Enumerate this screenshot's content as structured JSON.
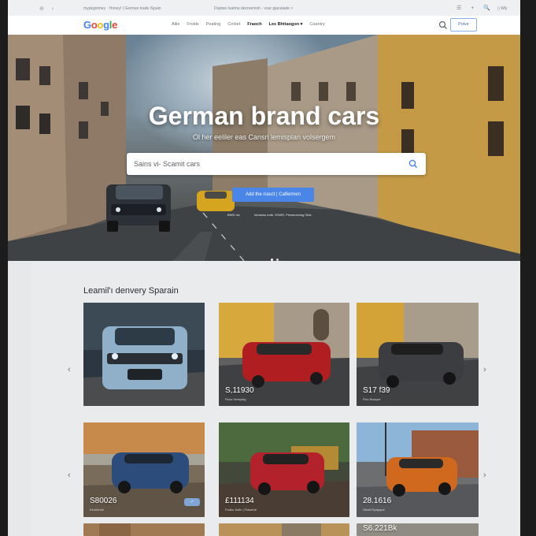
{
  "browser": {
    "nav_icons": "⊖ ›",
    "url": "mypkgiomey · Honey! | German trade iSpain",
    "tab": "Doptao loatma decreemoh - vour pjansiade ×",
    "tools": "☰ + 🔍",
    "user": "▯ Wly"
  },
  "header": {
    "logo_letters": [
      "G",
      "o",
      "o",
      "g",
      "l",
      "e"
    ],
    "menu": [
      "Allie",
      "Frolds",
      "Peating",
      "Crcket",
      "Fraoch",
      "Les Bhttaogon ▾",
      "Ceantry"
    ],
    "active_index": 4,
    "strong_index": 5,
    "login_label": "Polve"
  },
  "hero": {
    "title": "German brand cars",
    "subtitle": "Ol her eeliler eas Cansri lemisplan volsergem",
    "search_placeholder": "Sains vi- Scamit cars",
    "cta_label": "Add the rrasct | Calfermen",
    "small_left": "BWD nio",
    "small_right": "Inlowtao rrote, E2WR, Pecseosning Olds"
  },
  "listing": {
    "title": "Leamil'ı denvery Sparain",
    "arrow_left": "‹",
    "arrow_right": "›",
    "cards": [
      {
        "price": "",
        "loc": "",
        "badge": ""
      },
      {
        "price": "S,11930",
        "loc": "Fivnc Hemyirig",
        "badge": ""
      },
      {
        "price": "S17 f39",
        "loc": "Fivn Stcepre",
        "badge": ""
      },
      {
        "price": "S80026",
        "loc": "Eersirirole",
        "badge": "·⁄·"
      },
      {
        "price": "£111134",
        "loc": "Fcabo Jinltn | Flawerie",
        "badge": ""
      },
      {
        "price": "28.1616",
        "loc": "Siewil Rpapque",
        "badge": ""
      },
      {
        "price": "",
        "loc": "",
        "badge": ""
      },
      {
        "price": "",
        "loc": "",
        "badge": ""
      },
      {
        "price": "S6.221Bk",
        "loc": "",
        "badge": ""
      }
    ]
  },
  "colors": {
    "accent": "#4a86e8",
    "header_bg": "#ffffff",
    "panel_bg": "#e9ebed"
  }
}
